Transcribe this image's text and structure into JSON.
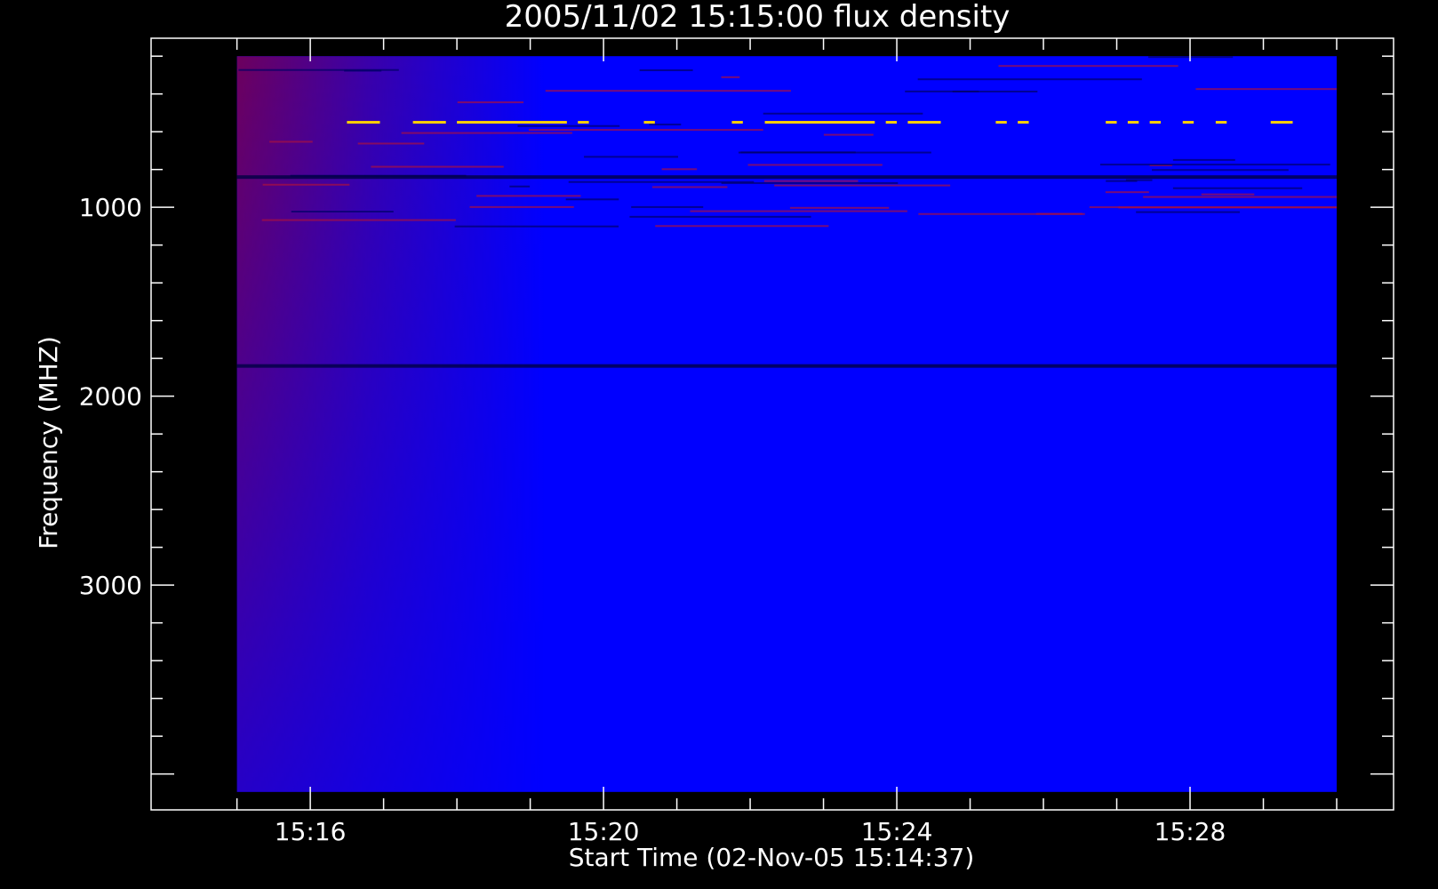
{
  "chart_data": {
    "type": "heatmap",
    "title": "2005/11/02 15:15:00 flux density",
    "xlabel": "Start Time (02-Nov-05 15:14:37)",
    "ylabel": "Frequency (MHZ)",
    "x_range_minutes": [
      "15:14:37",
      "15:30:00"
    ],
    "ylim_mhz": [
      105,
      4190
    ],
    "y_data_range_mhz": [
      200,
      4095
    ],
    "x_ticks": [
      {
        "value": "15:16",
        "label": "15:16"
      },
      {
        "value": "15:20",
        "label": "15:20"
      },
      {
        "value": "15:24",
        "label": "15:24"
      },
      {
        "value": "15:28",
        "label": "15:28"
      }
    ],
    "y_ticks": [
      {
        "value": 1000,
        "label": "1000"
      },
      {
        "value": 2000,
        "label": "2000"
      },
      {
        "value": 3000,
        "label": "3000"
      }
    ],
    "y_inverted": true,
    "grid": false,
    "colormap": {
      "low": "#0000ff",
      "mid": "#800040",
      "high": "#ffd000"
    },
    "features": [
      {
        "kind": "intermittent_bright_line",
        "freq_mhz": 550,
        "level": "high"
      },
      {
        "kind": "dark_band",
        "freq_mhz": 840,
        "level": "low"
      },
      {
        "kind": "dark_band",
        "freq_mhz": 1840,
        "level": "low"
      },
      {
        "kind": "emission_region",
        "time_range": [
          "15:15:00",
          "15:18:00"
        ],
        "freq_range_mhz": [
          200,
          4095
        ],
        "level": "mid"
      }
    ]
  }
}
